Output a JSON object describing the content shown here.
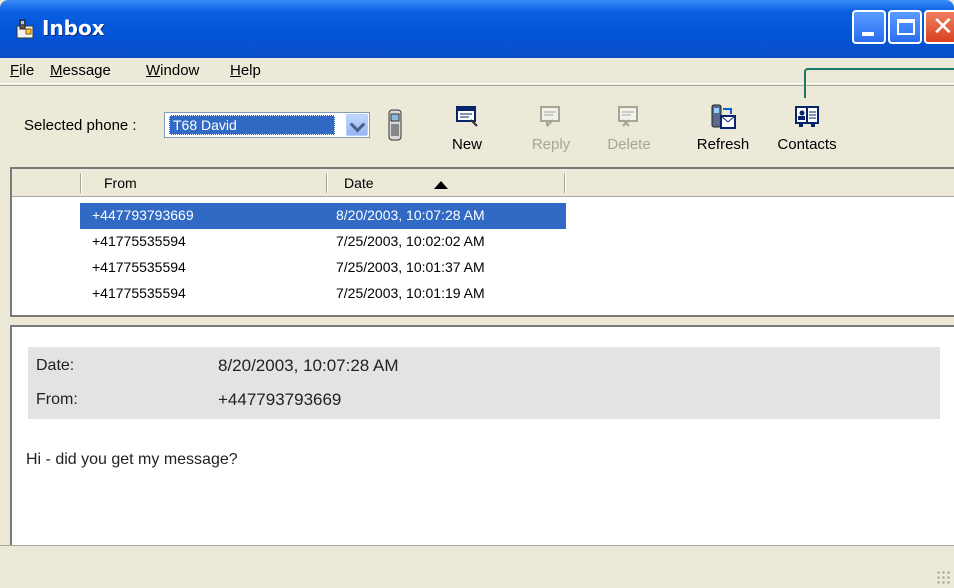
{
  "window": {
    "title": "Inbox",
    "icon": "phone-mailbox-icon"
  },
  "menu": [
    {
      "label": "File",
      "accel": "F",
      "rest": "ile"
    },
    {
      "label": "Message",
      "accel": "M",
      "rest": "essage"
    },
    {
      "label": "Window",
      "accel": "W",
      "rest": "indow"
    },
    {
      "label": "Help",
      "accel": "H",
      "rest": "elp"
    }
  ],
  "toolbar": {
    "phone_label": "Selected phone :",
    "phone_value": "T68 David",
    "new_label": "New",
    "reply_label": "Reply",
    "delete_label": "Delete",
    "refresh_label": "Refresh",
    "contacts_label": "Contacts"
  },
  "list": {
    "columns": {
      "from": "From",
      "date": "Date"
    },
    "rows": [
      {
        "from": "+447793793669",
        "date": "8/20/2003, 10:07:28 AM",
        "selected": true
      },
      {
        "from": "+41775535594",
        "date": "7/25/2003, 10:02:02 AM",
        "selected": false
      },
      {
        "from": "+41775535594",
        "date": "7/25/2003, 10:01:37 AM",
        "selected": false
      },
      {
        "from": "+41775535594",
        "date": "7/25/2003, 10:01:19 AM",
        "selected": false
      }
    ]
  },
  "message": {
    "date_label": "Date:",
    "date_value": "8/20/2003, 10:07:28 AM",
    "from_label": "From:",
    "from_value": "+447793793669",
    "body": "Hi - did you get my message?"
  },
  "colors": {
    "selection": "#316ac5",
    "titlebar": "#0354d8",
    "callout": "#1a7a6a"
  }
}
